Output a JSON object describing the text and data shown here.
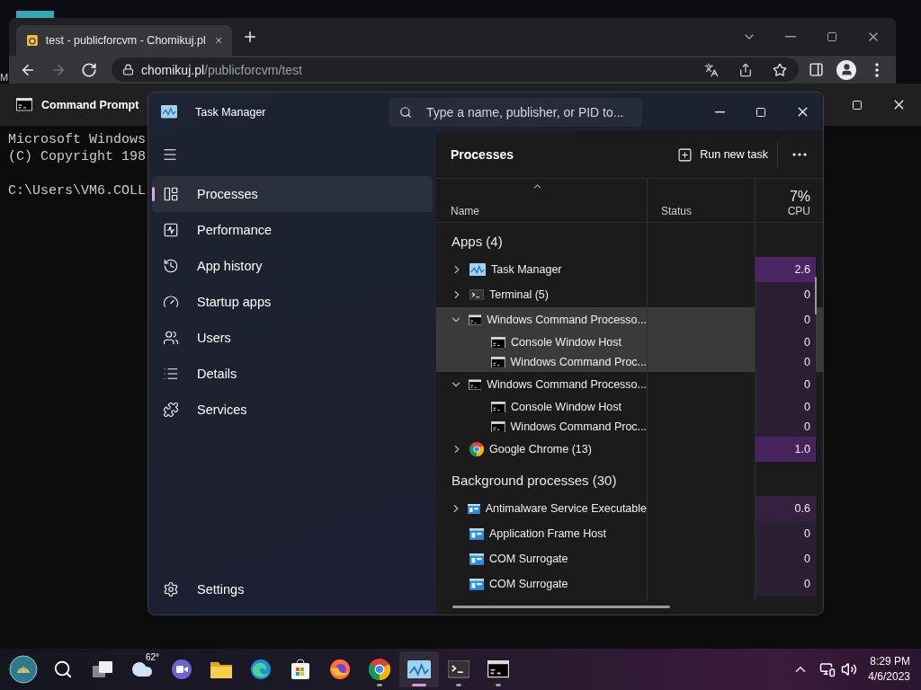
{
  "desktop": {
    "fragment": "M"
  },
  "browser": {
    "tab": {
      "title": "test - publicforcvm - Chomikuj.pl"
    },
    "nav": [
      {
        "kind": "back",
        "disabled": false
      },
      {
        "kind": "forward",
        "disabled": true
      },
      {
        "kind": "reload",
        "disabled": false
      }
    ],
    "address": {
      "host": "chomikuj.pl",
      "path": "/publicforcvm/test"
    }
  },
  "console": {
    "title": "Command Prompt",
    "paragraphs": [
      [
        "Microsoft Windows",
        "(C) Copyright 198"
      ],
      [
        "C:\\Users\\VM6.COLL"
      ]
    ]
  },
  "task_manager": {
    "title": "Task Manager",
    "search": {
      "placeholder": "Type a name, publisher, or PID to..."
    },
    "nav": [
      {
        "kind": "processes",
        "label": "Processes",
        "selected": true
      },
      {
        "kind": "performance",
        "label": "Performance",
        "selected": false
      },
      {
        "kind": "history",
        "label": "App history",
        "selected": false
      },
      {
        "kind": "startup",
        "label": "Startup apps",
        "selected": false
      },
      {
        "kind": "users",
        "label": "Users",
        "selected": false
      },
      {
        "kind": "details",
        "label": "Details",
        "selected": false
      },
      {
        "kind": "services",
        "label": "Services",
        "selected": false
      }
    ],
    "settings": {
      "label": "Settings"
    },
    "page_title": "Processes",
    "run_task": "Run new task",
    "columns": {
      "name": "Name",
      "status": "Status",
      "cpu_total": "7%",
      "cpu": "CPU"
    },
    "groups": [
      {
        "title": "Apps (4)",
        "rows": [
          {
            "kind": "taskmgr",
            "name": "Task Manager",
            "cpu": "2.6",
            "color": "#4b2562",
            "expanded": false,
            "highlighted": false
          },
          {
            "kind": "terminal",
            "name": "Terminal (5)",
            "cpu": "0",
            "color": "#2a1e33",
            "expanded": false,
            "highlighted": false
          },
          {
            "kind": "cmd",
            "name": "Windows Command Processo...",
            "cpu": "0",
            "color": "#2a1e33",
            "expanded": true,
            "highlighted": true,
            "children": [
              {
                "kind": "cmd",
                "name": "Console Window Host",
                "cpu": "0",
                "color": "#2a1e33",
                "highlighted": true
              },
              {
                "kind": "cmd",
                "name": "Windows Command Proc...",
                "cpu": "0",
                "color": "#2a1e33",
                "highlighted": true
              }
            ]
          },
          {
            "kind": "cmd",
            "name": "Windows Command Processo...",
            "cpu": "0",
            "color": "#2a1e33",
            "expanded": true,
            "highlighted": false,
            "children": [
              {
                "kind": "cmd",
                "name": "Console Window Host",
                "cpu": "0",
                "color": "#2a1e33",
                "highlighted": false
              },
              {
                "kind": "cmd",
                "name": "Windows Command Proc...",
                "cpu": "0",
                "color": "#2a1e33",
                "highlighted": false
              }
            ]
          },
          {
            "kind": "chrome",
            "name": "Google Chrome (13)",
            "cpu": "1.0",
            "color": "#46235a",
            "expanded": false,
            "highlighted": false
          }
        ]
      },
      {
        "title": "Background processes (30)",
        "rows": [
          {
            "kind": "service",
            "name": "Antimalware Service Executable",
            "cpu": "0.6",
            "color": "#36203f",
            "expanded": false,
            "highlighted": false
          },
          {
            "kind": "service",
            "name": "Application Frame Host",
            "cpu": "0",
            "color": "#2a1e33",
            "highlighted": false
          },
          {
            "kind": "service",
            "name": "COM Surrogate",
            "cpu": "0",
            "color": "#2a1e33",
            "highlighted": false
          },
          {
            "kind": "service",
            "name": "COM Surrogate",
            "cpu": "0",
            "color": "#2a1e33",
            "highlighted": false
          }
        ]
      }
    ]
  },
  "taskbar": {
    "apps": [
      {
        "kind": "start",
        "running": false,
        "active": false
      },
      {
        "kind": "search",
        "running": false,
        "active": false
      },
      {
        "kind": "taskview",
        "running": false,
        "active": false
      },
      {
        "kind": "weather",
        "label": "62°",
        "running": false,
        "active": false
      },
      {
        "kind": "chat",
        "running": false,
        "active": false
      },
      {
        "kind": "explorer",
        "running": false,
        "active": false
      },
      {
        "kind": "edge",
        "running": false,
        "active": false
      },
      {
        "kind": "store",
        "running": false,
        "active": false
      },
      {
        "kind": "firefox",
        "running": false,
        "active": false
      },
      {
        "kind": "chrome",
        "running": true,
        "active": false
      },
      {
        "kind": "taskmgr",
        "running": true,
        "active": true
      },
      {
        "kind": "terminal",
        "running": true,
        "active": false
      },
      {
        "kind": "cmd",
        "running": true,
        "active": false
      }
    ],
    "time": "8:29 PM",
    "date": "4/6/2023"
  }
}
